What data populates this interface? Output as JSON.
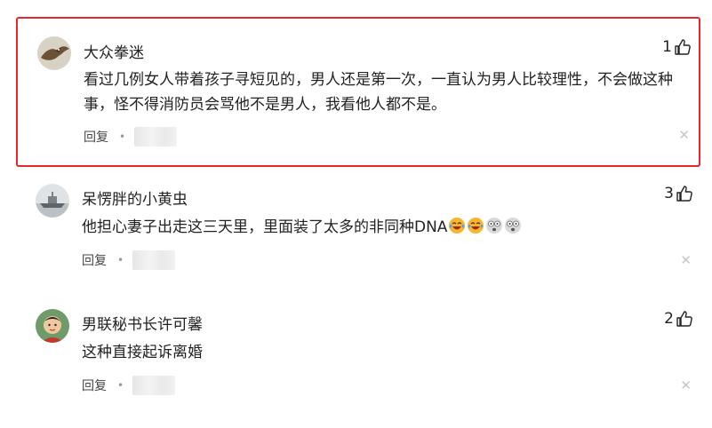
{
  "comments": [
    {
      "username": "大众拳迷",
      "likes": "1",
      "text": "看过几例女人带着孩子寻短见的，男人还是第一次，一直认为男人比较理性，不会做这种事，怪不得消防员会骂他不是男人，我看他人都不是。",
      "reply_label": "回复",
      "emojis": [],
      "avatar_icon": "eagle-avatar-icon"
    },
    {
      "username": "呆愣胖的小黄虫",
      "likes": "3",
      "text": "他担心妻子出走这三天里，里面装了太多的非同种DNA",
      "reply_label": "回复",
      "emojis": [
        "laugh-cry-emoji",
        "laugh-cry-emoji",
        "shocked-emoji",
        "shocked-emoji"
      ],
      "avatar_icon": "ship-avatar-icon"
    },
    {
      "username": "男联秘书长许可馨",
      "likes": "2",
      "text": "这种直接起诉离婚",
      "reply_label": "回复",
      "emojis": [],
      "avatar_icon": "child-avatar-icon"
    }
  ],
  "colors": {
    "highlight_border": "#e8262d",
    "text": "#222222",
    "muted": "#999999"
  },
  "icons": {
    "like": "thumbs-up-icon",
    "close": "close-icon"
  }
}
